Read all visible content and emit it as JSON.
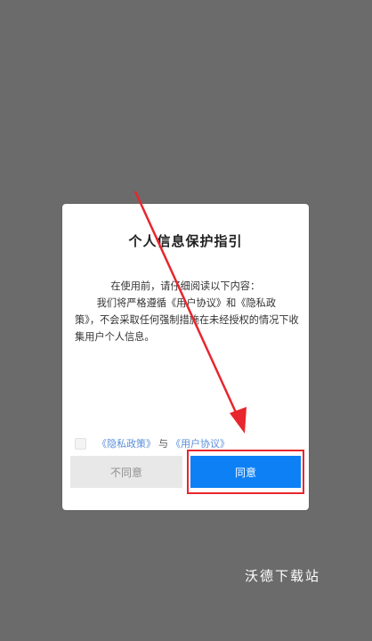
{
  "dialog": {
    "title": "个人信息保护指引",
    "body": {
      "line1": "在使用前，请仔细阅读以下内容：",
      "line2": "我们将严格遵循《用户协议》和《隐私政策》，不会采取任何强制措施在未经授权的情况下收集用户个人信息。"
    },
    "agreement": {
      "privacy_link": "《隐私政策》",
      "conjunction": "与",
      "user_link": "《用户协议》"
    },
    "buttons": {
      "disagree_label": "不同意",
      "agree_label": "同意"
    }
  },
  "watermark": "沃德下载站",
  "colors": {
    "overlay": "#6b6b6b",
    "agree_button": "#0d80f5",
    "disagree_button": "#e8e8e8",
    "link": "#5a8fd8",
    "annotation": "#e8262d"
  }
}
